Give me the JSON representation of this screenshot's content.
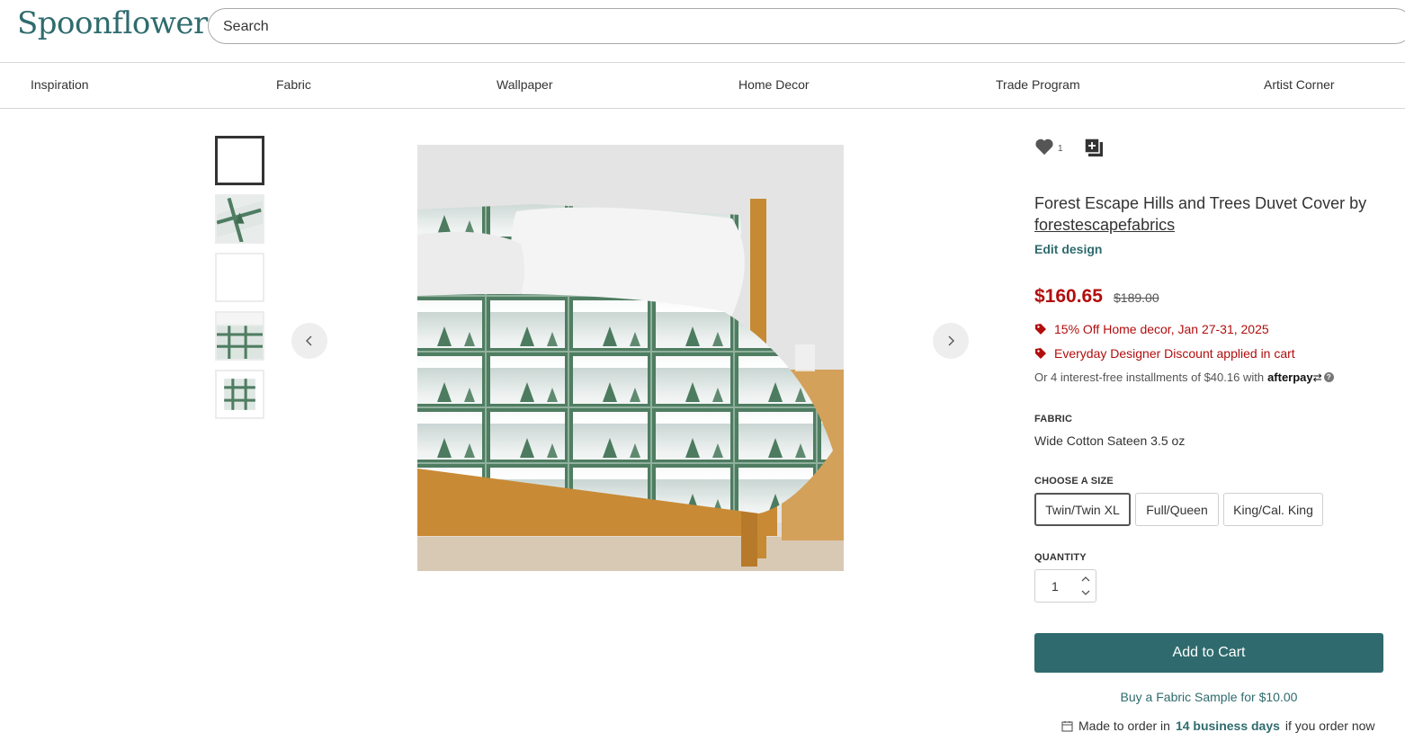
{
  "header": {
    "logo": "Spoonflower",
    "search_placeholder": "Search"
  },
  "nav": {
    "items": [
      "Inspiration",
      "Fabric",
      "Wallpaper",
      "Home Decor",
      "Trade Program",
      "Artist Corner"
    ]
  },
  "product": {
    "favorite_count": "1",
    "title": "Forest Escape Hills and Trees Duvet Cover by",
    "artist": "forestescapefabrics",
    "edit_label": "Edit design",
    "price": "$160.65",
    "old_price": "$189.00",
    "promos": [
      "15% Off Home decor, Jan 27-31, 2025",
      "Everyday Designer Discount applied in cart"
    ],
    "installments": "Or 4 interest-free installments of $40.16 with",
    "afterpay": "afterpay",
    "fabric_label": "FABRIC",
    "fabric_value": "Wide Cotton Sateen 3.5 oz",
    "size_label": "CHOOSE A SIZE",
    "sizes": [
      "Twin/Twin XL",
      "Full/Queen",
      "King/Cal. King"
    ],
    "selected_size": "Twin/Twin XL",
    "quantity_label": "QUANTITY",
    "quantity": "1",
    "add_to_cart": "Add to Cart",
    "sample_link": "Buy a Fabric Sample for $10.00",
    "made_prefix": "Made to order in",
    "made_days": "14 business days",
    "made_suffix": "if you order now"
  },
  "colors": {
    "brand": "#2f6b6e",
    "sale": "#b20d0d",
    "plaid_green": "#4f7d62"
  }
}
